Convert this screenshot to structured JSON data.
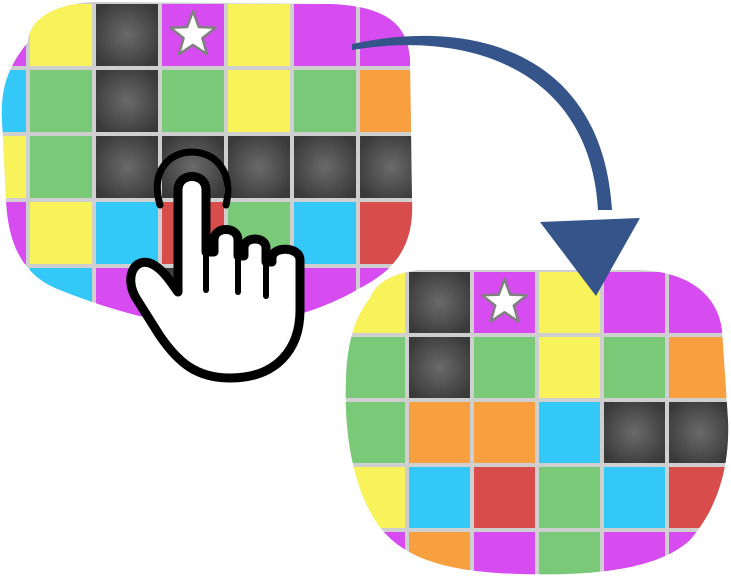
{
  "colors": {
    "Y": "#f8f35a",
    "D": "#4a4a4a",
    "P": "#d64cf0",
    "G": "#79c979",
    "O": "#f8a040",
    "B": "#33c8f7",
    "R": "#d84c4c",
    "grid_line": "#cfcfcf",
    "arrow": "#34548a",
    "hand_fill": "#ffffff",
    "hand_outline": "#000000",
    "star_fill": "#ffffff",
    "star_outline": "#808080"
  },
  "board_before": {
    "rows": [
      [
        "P",
        "Y",
        "D",
        "P",
        "Y",
        "P",
        "P"
      ],
      [
        "B",
        "G",
        "D",
        "G",
        "Y",
        "G",
        "O"
      ],
      [
        "Y",
        "G",
        "D",
        "D",
        "D",
        "D",
        "D"
      ],
      [
        "P",
        "Y",
        "B",
        "R",
        "G",
        "B",
        "R"
      ],
      [
        "B",
        "B",
        "P",
        "D",
        "P",
        "P",
        "P"
      ]
    ],
    "star": {
      "row": 0,
      "col": 3
    },
    "tap": {
      "row": 2,
      "col": 3
    }
  },
  "board_after": {
    "rows": [
      [
        "Y",
        "D",
        "P",
        "Y",
        "P",
        "P"
      ],
      [
        "G",
        "D",
        "G",
        "Y",
        "G",
        "O"
      ],
      [
        "G",
        "O",
        "O",
        "B",
        "D",
        "D"
      ],
      [
        "Y",
        "B",
        "R",
        "G",
        "B",
        "R"
      ],
      [
        "P",
        "O",
        "P",
        "G",
        "P",
        "P"
      ]
    ],
    "star": {
      "row": 0,
      "col": 2
    }
  },
  "icons": {
    "hand": "pointing-hand-icon",
    "arrow": "curved-arrow-icon",
    "star": "star-icon"
  }
}
